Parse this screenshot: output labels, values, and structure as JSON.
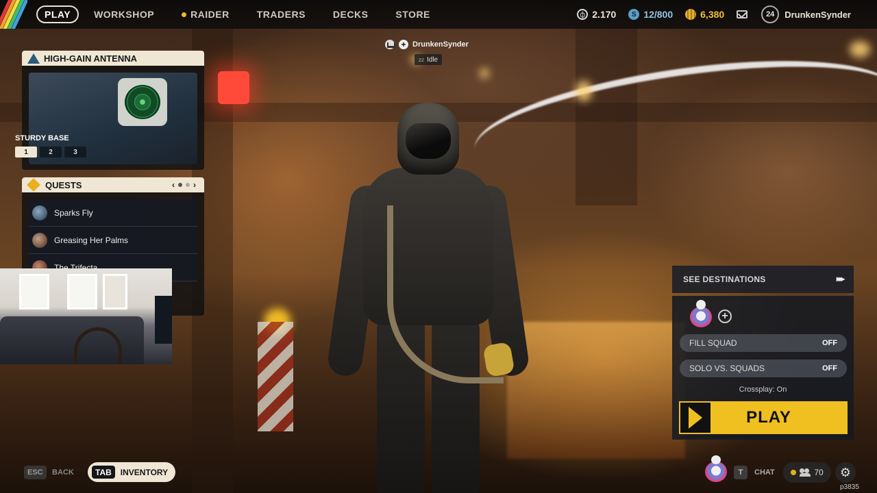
{
  "nav": {
    "items": [
      {
        "label": "PLAY",
        "active": true
      },
      {
        "label": "WORKSHOP"
      },
      {
        "label": "RAIDER",
        "icon": "notification-dot"
      },
      {
        "label": "TRADERS"
      },
      {
        "label": "DECKS"
      },
      {
        "label": "STORE"
      }
    ]
  },
  "currencies": {
    "coins": "2.170",
    "seeds": "12/800",
    "creds": "6,380"
  },
  "profile": {
    "level": "24",
    "username": "DrunkenSynder"
  },
  "antenna": {
    "title": "HIGH-GAIN ANTENNA",
    "subtitle": "STURDY BASE",
    "tiers": [
      "1",
      "2",
      "3"
    ],
    "active_tier": 1
  },
  "quests": {
    "title": "QUESTS",
    "pager": {
      "prev": "‹",
      "next": "›"
    },
    "items": [
      {
        "name": "Sparks Fly"
      },
      {
        "name": "Greasing Her Palms"
      },
      {
        "name": "The Trifecta"
      }
    ]
  },
  "player_tag": {
    "name": "DrunkenSynder",
    "status": "Idle"
  },
  "play_panel": {
    "destinations_label": "SEE DESTINATIONS",
    "destinations_arrow": "▸▸▸",
    "fill_squad_label": "FILL SQUAD",
    "fill_squad_value": "OFF",
    "solo_label": "SOLO VS. SQUADS",
    "solo_value": "OFF",
    "crossplay": "Crossplay: On",
    "play_label": "PLAY"
  },
  "bottom": {
    "esc_key": "ESC",
    "back_label": "BACK",
    "tab_key": "TAB",
    "inventory_label": "INVENTORY",
    "chat_key": "T",
    "chat_label": "CHAT",
    "friends_count": "70",
    "version": "p3835"
  },
  "colors": {
    "accent": "#f0c020",
    "header_bg": "#efe7d4",
    "seeds": "#8fc4e6",
    "creds": "#f0c040"
  }
}
